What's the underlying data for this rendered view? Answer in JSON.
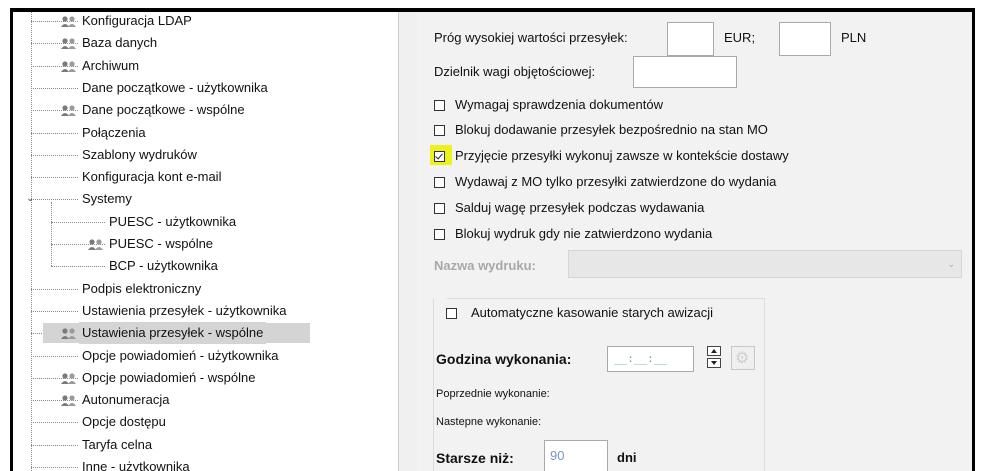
{
  "tree": {
    "items": [
      {
        "label": "Konfiguracja LDAP",
        "icon": "users-icon"
      },
      {
        "label": "Baza danych",
        "icon": "users-icon"
      },
      {
        "label": "Archiwum",
        "icon": "users-icon"
      },
      {
        "label": "Dane początkowe - użytkownika",
        "icon": ""
      },
      {
        "label": "Dane początkowe - wspólne",
        "icon": "users-icon"
      },
      {
        "label": "Połączenia",
        "icon": ""
      },
      {
        "label": "Szablony wydruków",
        "icon": ""
      },
      {
        "label": "Konfiguracja kont e-mail",
        "icon": ""
      },
      {
        "label": "Systemy",
        "icon": "",
        "expanded": true
      },
      {
        "label": "PUESC - użytkownika",
        "icon": ""
      },
      {
        "label": "PUESC - wspólne",
        "icon": "users-icon"
      },
      {
        "label": "BCP - użytkownika",
        "icon": ""
      },
      {
        "label": "Podpis elektroniczny",
        "icon": ""
      },
      {
        "label": "Ustawienia przesyłek - użytkownika",
        "icon": ""
      },
      {
        "label": "Ustawienia przesyłek - wspólne",
        "icon": "users-icon",
        "selected": true
      },
      {
        "label": "Opcje powiadomień - użytkownika",
        "icon": ""
      },
      {
        "label": "Opcje powiadomień - wspólne",
        "icon": "users-icon"
      },
      {
        "label": "Autonumeracja",
        "icon": "users-icon"
      },
      {
        "label": "Opcje dostępu",
        "icon": ""
      },
      {
        "label": "Taryfa celna",
        "icon": ""
      },
      {
        "label": "Inne - użytkownika",
        "icon": ""
      }
    ]
  },
  "settings": {
    "threshold_label": "Próg wysokiej wartości przesyłek:",
    "threshold_eur_value": "",
    "currency_eur": "EUR;",
    "threshold_pln_value": "",
    "currency_pln": "PLN",
    "divisor_label": "Dzielnik wagi objętościowej:",
    "divisor_value": "",
    "checkboxes": [
      {
        "label": "Wymagaj sprawdzenia dokumentów",
        "checked": false
      },
      {
        "label": "Blokuj dodawanie przesyłek bezpośrednio na stan MO",
        "checked": false
      },
      {
        "label": "Przyjęcie przesyłki wykonuj zawsze w kontekście dostawy",
        "checked": true
      },
      {
        "label": "Wydawaj z MO tylko przesyłki zatwierdzone do wydania",
        "checked": false
      },
      {
        "label": "Salduj wagę przesyłek podczas wydawania",
        "checked": false
      },
      {
        "label": "Blokuj wydruk gdy nie zatwierdzono wydania",
        "checked": false
      }
    ],
    "print_name_label": "Nazwa wydruku:",
    "print_name_value": "",
    "auto_delete": {
      "label": "Automatyczne kasowanie starych awizacji",
      "checked": false,
      "time_label": "Godzina wykonania:",
      "time_value": "__:__:__",
      "previous_label": "Poprzednie wykonanie:",
      "next_label": "Nastepne wykonanie:",
      "older_label": "Starsze niż:",
      "older_value": "90",
      "days_label": "dni"
    }
  },
  "colors": {
    "highlight": "#eef21c",
    "selection": "#d4d4d4",
    "panel": "#f2f2f2"
  }
}
